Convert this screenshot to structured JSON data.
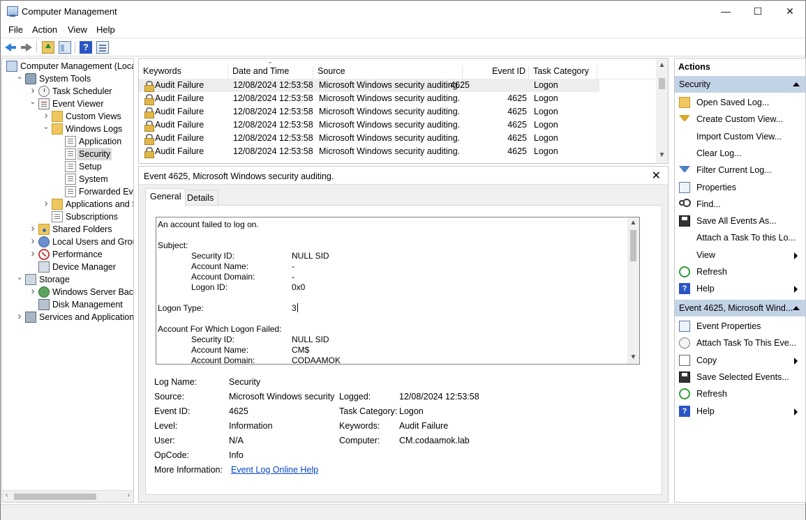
{
  "window": {
    "title": "Computer Management",
    "controls": [
      "—",
      "☐",
      "✕"
    ]
  },
  "menu": [
    "File",
    "Action",
    "View",
    "Help"
  ],
  "tree": [
    {
      "label": "Computer Management (Local",
      "icon": "computer-icon",
      "level": 0,
      "expander": ""
    },
    {
      "label": "System Tools",
      "icon": "tools-icon",
      "level": 1,
      "expander": "expanded"
    },
    {
      "label": "Task Scheduler",
      "icon": "clock-icon",
      "level": 2,
      "expander": "collapsed"
    },
    {
      "label": "Event Viewer",
      "icon": "event-viewer-icon",
      "level": 2,
      "expander": "expanded"
    },
    {
      "label": "Custom Views",
      "icon": "folder-icon",
      "level": 3,
      "expander": "collapsed"
    },
    {
      "label": "Windows Logs",
      "icon": "folder-icon",
      "level": 3,
      "expander": "expanded"
    },
    {
      "label": "Application",
      "icon": "log-icon",
      "level": 4,
      "expander": ""
    },
    {
      "label": "Security",
      "icon": "log-icon",
      "level": 4,
      "expander": "",
      "selected": true
    },
    {
      "label": "Setup",
      "icon": "log-icon",
      "level": 4,
      "expander": ""
    },
    {
      "label": "System",
      "icon": "log-icon",
      "level": 4,
      "expander": ""
    },
    {
      "label": "Forwarded Event",
      "icon": "log-icon",
      "level": 4,
      "expander": ""
    },
    {
      "label": "Applications and Se",
      "icon": "folder-icon",
      "level": 3,
      "expander": "collapsed"
    },
    {
      "label": "Subscriptions",
      "icon": "log-icon",
      "level": 3,
      "expander": ""
    },
    {
      "label": "Shared Folders",
      "icon": "shared-folder-icon",
      "level": 2,
      "expander": "collapsed"
    },
    {
      "label": "Local Users and Groups",
      "icon": "users-icon",
      "level": 2,
      "expander": "collapsed"
    },
    {
      "label": "Performance",
      "icon": "performance-icon",
      "level": 2,
      "expander": "collapsed"
    },
    {
      "label": "Device Manager",
      "icon": "device-manager-icon",
      "level": 2,
      "expander": ""
    },
    {
      "label": "Storage",
      "icon": "storage-icon",
      "level": 1,
      "expander": "expanded"
    },
    {
      "label": "Windows Server Backup",
      "icon": "backup-icon",
      "level": 2,
      "expander": "collapsed"
    },
    {
      "label": "Disk Management",
      "icon": "disk-icon",
      "level": 2,
      "expander": ""
    },
    {
      "label": "Services and Applications",
      "icon": "services-icon",
      "level": 1,
      "expander": "collapsed"
    }
  ],
  "event_list": {
    "columns": [
      "Keywords",
      "Date and Time",
      "Source",
      "Event ID",
      "Task Category"
    ],
    "rows": [
      {
        "keywords": "Audit Failure",
        "date": "12/08/2024 12:53:58",
        "source": "Microsoft Windows security auditing.",
        "event_id": "4625",
        "category": "Logon"
      },
      {
        "keywords": "Audit Failure",
        "date": "12/08/2024 12:53:58",
        "source": "Microsoft Windows security auditing.",
        "event_id": "4625",
        "category": "Logon"
      },
      {
        "keywords": "Audit Failure",
        "date": "12/08/2024 12:53:58",
        "source": "Microsoft Windows security auditing.",
        "event_id": "4625",
        "category": "Logon"
      },
      {
        "keywords": "Audit Failure",
        "date": "12/08/2024 12:53:58",
        "source": "Microsoft Windows security auditing.",
        "event_id": "4625",
        "category": "Logon"
      },
      {
        "keywords": "Audit Failure",
        "date": "12/08/2024 12:53:58",
        "source": "Microsoft Windows security auditing.",
        "event_id": "4625",
        "category": "Logon"
      },
      {
        "keywords": "Audit Failure",
        "date": "12/08/2024 12:53:58",
        "source": "Microsoft Windows security auditing.",
        "event_id": "4625",
        "category": "Logon"
      }
    ]
  },
  "detail": {
    "title": "Event 4625, Microsoft Windows security auditing.",
    "tabs": [
      "General",
      "Details"
    ],
    "description": [
      {
        "label": "An account failed to log on.",
        "value": "",
        "indent": 0
      },
      {
        "label": "",
        "value": "",
        "indent": 0
      },
      {
        "label": "Subject:",
        "value": "",
        "indent": 0
      },
      {
        "label": "Security ID:",
        "value": "NULL SID",
        "indent": 1
      },
      {
        "label": "Account Name:",
        "value": "-",
        "indent": 1
      },
      {
        "label": "Account Domain:",
        "value": "-",
        "indent": 1
      },
      {
        "label": "Logon ID:",
        "value": "0x0",
        "indent": 1
      },
      {
        "label": "",
        "value": "",
        "indent": 0
      },
      {
        "label": "Logon Type:",
        "value": "3",
        "indent": 0,
        "caret": true
      },
      {
        "label": "",
        "value": "",
        "indent": 0
      },
      {
        "label": "Account For Which Logon Failed:",
        "value": "",
        "indent": 0
      },
      {
        "label": "Security ID:",
        "value": "NULL SID",
        "indent": 1
      },
      {
        "label": "Account Name:",
        "value": "CM$",
        "indent": 1
      },
      {
        "label": "Account Domain:",
        "value": "CODAAMOK",
        "indent": 1
      }
    ],
    "fields": {
      "log_name": {
        "label": "Log Name:",
        "value": "Security"
      },
      "source": {
        "label": "Source:",
        "value": "Microsoft Windows security"
      },
      "logged": {
        "label": "Logged:",
        "value": "12/08/2024 12:53:58"
      },
      "event_id": {
        "label": "Event ID:",
        "value": "4625"
      },
      "task_category": {
        "label": "Task Category:",
        "value": "Logon"
      },
      "level": {
        "label": "Level:",
        "value": "Information"
      },
      "keywords": {
        "label": "Keywords:",
        "value": "Audit Failure"
      },
      "user": {
        "label": "User:",
        "value": "N/A"
      },
      "computer": {
        "label": "Computer:",
        "value": "CM.codaamok.lab"
      },
      "opcode": {
        "label": "OpCode:",
        "value": "Info"
      },
      "more_info": {
        "label": "More Information:",
        "value": "Event Log Online Help"
      }
    }
  },
  "actions": {
    "header": "Actions",
    "section1": {
      "title": "Security",
      "items": [
        {
          "label": "Open Saved Log...",
          "icon": "open-log-icon",
          "submenu": false
        },
        {
          "label": "Create Custom View...",
          "icon": "filter-icon",
          "submenu": false
        },
        {
          "label": "Import Custom View...",
          "icon": "",
          "submenu": false
        },
        {
          "label": "Clear Log...",
          "icon": "",
          "submenu": false
        },
        {
          "label": "Filter Current Log...",
          "icon": "filter-icon",
          "submenu": false
        },
        {
          "label": "Properties",
          "icon": "properties-icon",
          "submenu": false
        },
        {
          "label": "Find...",
          "icon": "find-icon",
          "submenu": false
        },
        {
          "label": "Save All Events As...",
          "icon": "save-icon",
          "submenu": false
        },
        {
          "label": "Attach a Task To this Lo...",
          "icon": "",
          "submenu": false
        },
        {
          "label": "View",
          "icon": "",
          "submenu": true
        },
        {
          "label": "Refresh",
          "icon": "refresh-icon",
          "submenu": false
        },
        {
          "label": "Help",
          "icon": "help-icon",
          "submenu": true
        }
      ]
    },
    "section2": {
      "title": "Event 4625, Microsoft Wind...",
      "items": [
        {
          "label": "Event Properties",
          "icon": "properties-icon",
          "submenu": false
        },
        {
          "label": "Attach Task To This Eve...",
          "icon": "task-icon",
          "submenu": false
        },
        {
          "label": "Copy",
          "icon": "copy-icon",
          "submenu": true
        },
        {
          "label": "Save Selected Events...",
          "icon": "save-icon",
          "submenu": false
        },
        {
          "label": "Refresh",
          "icon": "refresh-icon",
          "submenu": false
        },
        {
          "label": "Help",
          "icon": "help-icon",
          "submenu": true
        }
      ]
    }
  },
  "glyphs": {
    "collapsed": "›",
    "expanded": "⌄",
    "up": "▲",
    "down": "▼",
    "left": "‹",
    "right": "›",
    "sort": "⌄",
    "close": "✕",
    "help": "?"
  }
}
